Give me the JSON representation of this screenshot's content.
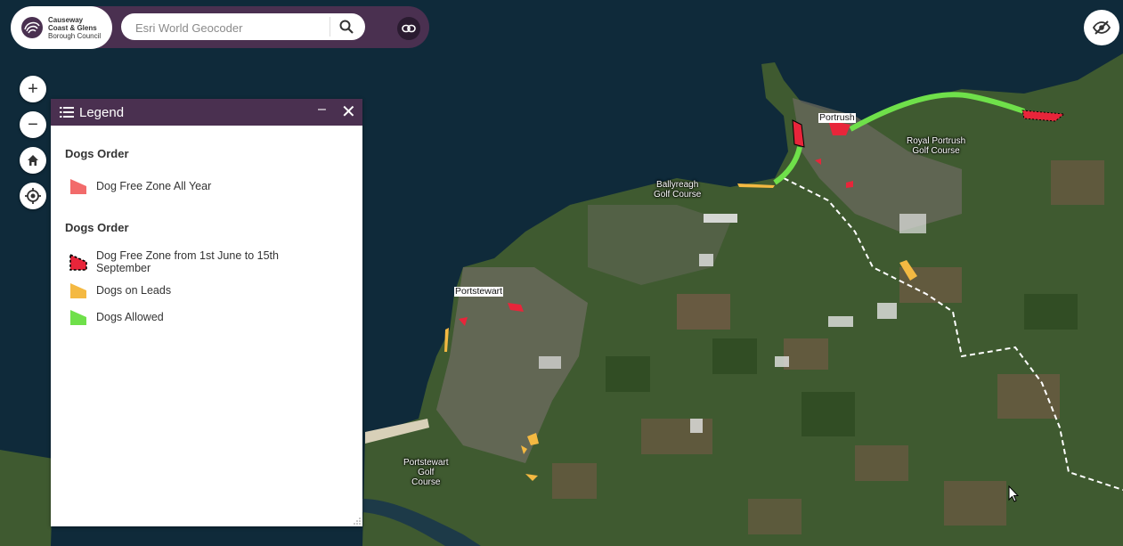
{
  "header": {
    "logo_lines": [
      "Causeway",
      "Coast & Glens",
      "Borough Council"
    ],
    "search_placeholder": "Esri World Geocoder"
  },
  "icons": {
    "search": "search-icon",
    "link": "link-icon",
    "visibility_toggle": "eye-off-icon",
    "zoom_in": "plus-icon",
    "zoom_out": "minus-icon",
    "home": "home-icon",
    "locate": "locate-icon",
    "legend": "list-icon",
    "minimize": "minimize-icon",
    "close": "close-icon"
  },
  "map_controls": {
    "zoom_in": "+",
    "zoom_out": "−"
  },
  "legend": {
    "title": "Legend",
    "minimize": "–",
    "close": "✕",
    "groups": [
      {
        "title": "Dogs Order",
        "items": [
          {
            "label": "Dog Free Zone All Year",
            "color": "#f26b6b"
          }
        ]
      },
      {
        "title": "Dogs Order",
        "items": [
          {
            "label": "Dog Free Zone from 1st June to 15th September",
            "color": "#e8253a"
          },
          {
            "label": "Dogs on Leads",
            "color": "#f4b942"
          },
          {
            "label": "Dogs Allowed",
            "color": "#6fe04a"
          }
        ]
      }
    ]
  },
  "map_labels": {
    "portrush": "Portrush",
    "portstewart": "Portstewart",
    "royal_portrush": [
      "Royal Portrush",
      "Golf Course"
    ],
    "ballyreagh": [
      "Ballyreagh",
      "Golf Course"
    ],
    "portstewart_golf": [
      "Portstewart",
      "Golf",
      "Course"
    ]
  },
  "colors": {
    "brand": "#4a3050",
    "sea": "#0f2a3a",
    "land": "#3d5a2c"
  }
}
